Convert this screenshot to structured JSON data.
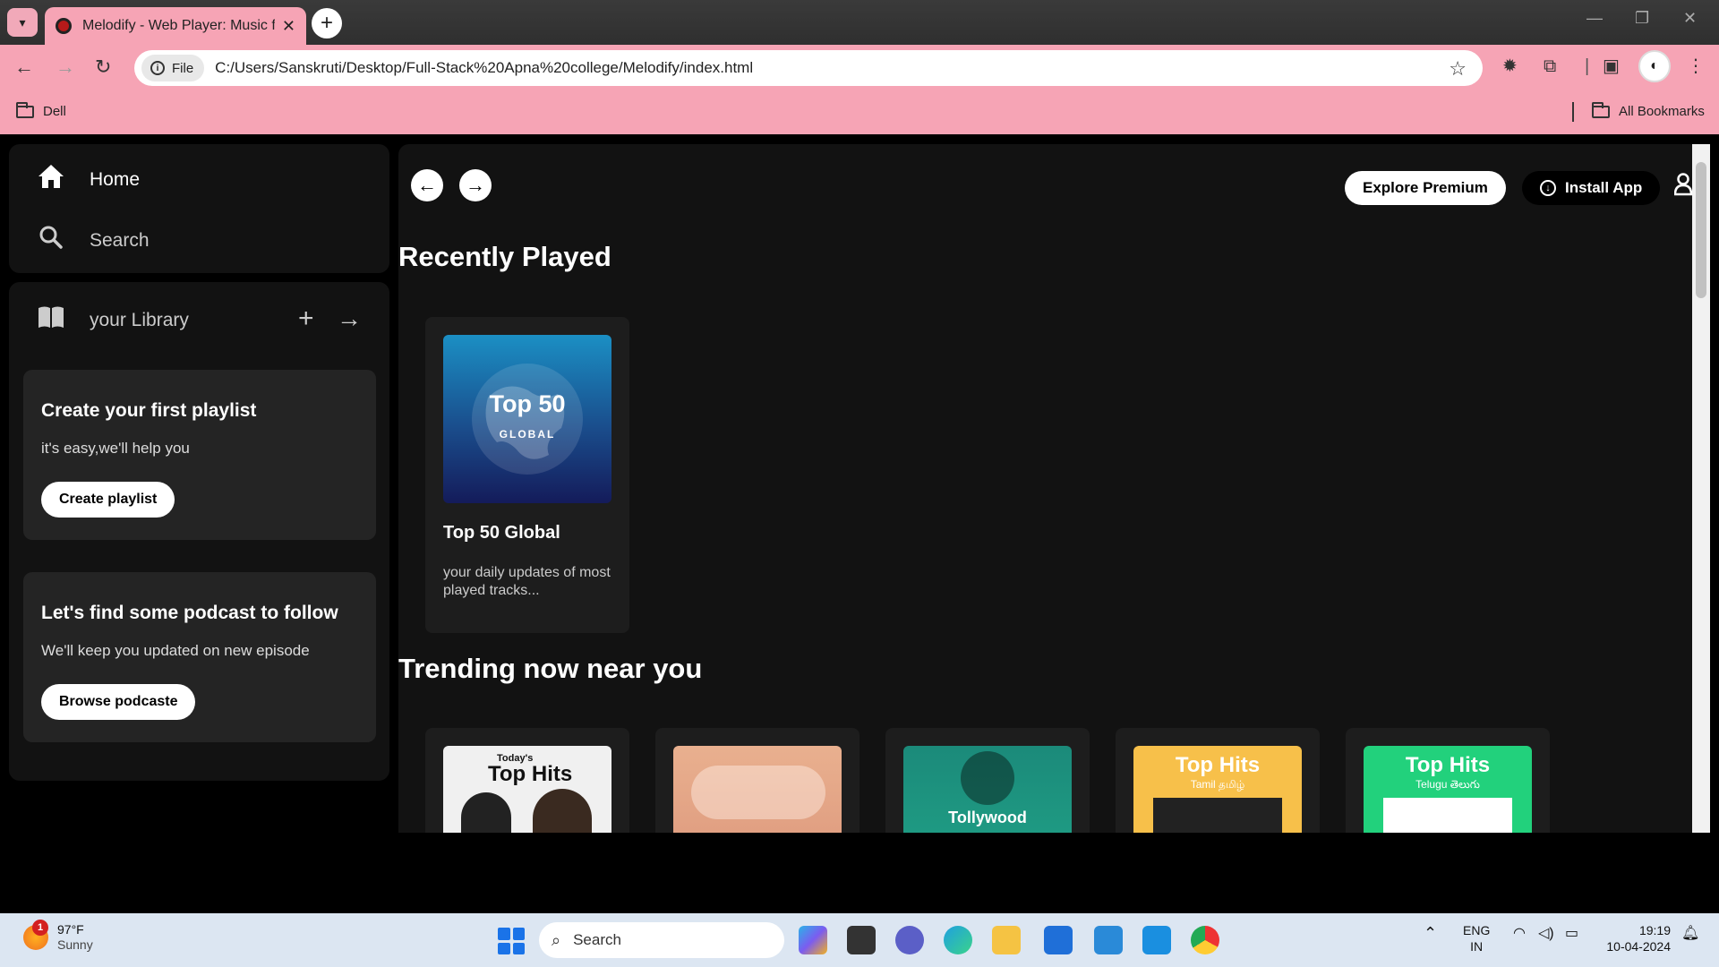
{
  "browser": {
    "tab_title": "Melodify - Web Player: Music for everyone",
    "url_scheme_label": "File",
    "url": "C:/Users/Sanskruti/Desktop/Full-Stack%20Apna%20college/Melodify/index.html",
    "bookmarks": {
      "left_folder": "Dell",
      "right_folder": "All Bookmarks"
    },
    "tab_bg": "#f6a4b5"
  },
  "sidebar": {
    "home_label": "Home",
    "search_label": "Search",
    "library_label": "your Library",
    "playlist_card": {
      "title": "Create your first playlist",
      "subtitle": "it's easy,we'll help you",
      "button": "Create playlist"
    },
    "podcast_card": {
      "title": "Let's find some podcast to follow",
      "subtitle": "We'll keep you updated on new episode",
      "button": "Browse podcaste"
    }
  },
  "header": {
    "explore_premium": "Explore Premium",
    "install_app": "Install App"
  },
  "recently_played": {
    "title": "Recently Played",
    "cards": [
      {
        "cover_title": "Top 50",
        "cover_sub": "GLOBAL",
        "title": "Top 50 Global",
        "desc": "your daily updates of most played tracks..."
      }
    ]
  },
  "trending": {
    "title": "Trending now near you",
    "cards": [
      {
        "cover_small": "Today's",
        "cover_main": "Top Hits",
        "bg": "#f0f0f0"
      },
      {
        "cover_small": "",
        "cover_main": "",
        "bg": "#e7a58a"
      },
      {
        "cover_small": "",
        "cover_main": "Tollywood",
        "bg": "#1f9d83"
      },
      {
        "cover_small": "Tamil தமிழ்",
        "cover_main": "Top Hits",
        "bg": "#f7c04a"
      },
      {
        "cover_small": "Telugu తెలుగు",
        "cover_main": "Top Hits",
        "bg": "#22d17c"
      }
    ]
  },
  "taskbar": {
    "weather_temp": "97°F",
    "weather_cond": "Sunny",
    "weather_badge": "1",
    "search_label": "Search",
    "lang_top": "ENG",
    "lang_bottom": "IN",
    "time": "19:19",
    "date": "10-04-2024"
  }
}
